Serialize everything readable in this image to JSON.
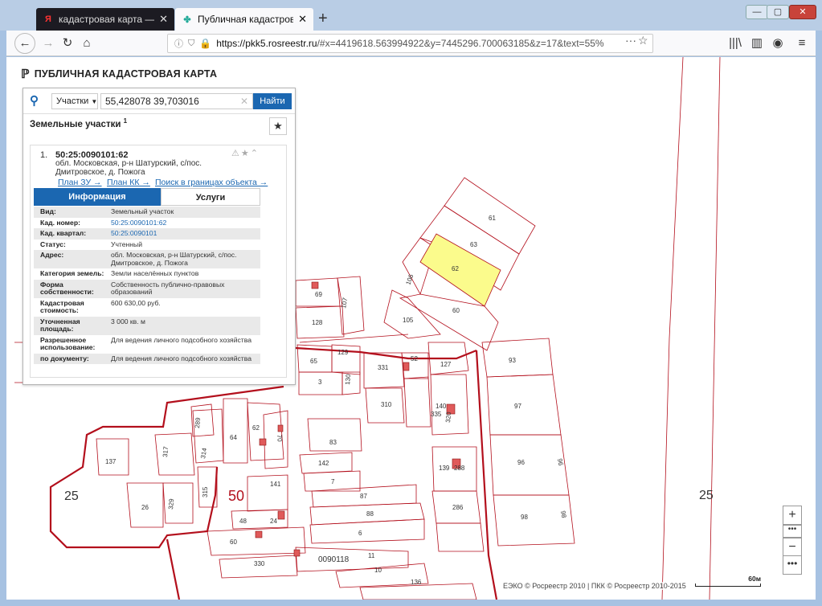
{
  "browser": {
    "tabs": [
      {
        "label": "кадастровая карта — Яндекс",
        "favicon": "Я"
      },
      {
        "label": "Публичная кадастровая карта",
        "favicon": "✤"
      }
    ],
    "new_tab_label": "+",
    "url_host": "https://pkk5.rosreestr.ru",
    "url_rest": "/#x=4419618.563994922&y=7445296.700063185&z=17&text=55%",
    "url_menu_glyph": "···",
    "window_buttons": {
      "min": "—",
      "max": "▢",
      "close": "✕"
    },
    "nav_glyphs": {
      "back": "←",
      "forward": "→",
      "reload": "↻",
      "home": "⌂",
      "bookmark": "☆",
      "library": "|||\\",
      "sidebar": "▥",
      "account": "◉",
      "menu": "≡"
    }
  },
  "header": {
    "title": "ПУБЛИЧНАЯ КАДАСТРОВАЯ КАРТА",
    "logo_glyph": "ℙ"
  },
  "search": {
    "type_label": "Участки",
    "query": "55,428078 39,703016",
    "clear_glyph": "✕",
    "find_label": "Найти",
    "search_glyph": "🔍"
  },
  "results": {
    "section_title": "Земельные участки",
    "count": "1",
    "star_glyph": "★",
    "item": {
      "index": "1.",
      "cad_number": "50:25:0090101:62",
      "address": "обл. Московская, р-н Шатурский, с/пос. Дмитровское, д. Пожога",
      "status_icons": "⚠★⌃",
      "links": [
        "План ЗУ →",
        "План КК →",
        "Поиск в границах объекта →"
      ]
    },
    "tabs": {
      "info": "Информация",
      "services": "Услуги"
    },
    "properties": [
      {
        "key": "Вид:",
        "value": "Земельный участок",
        "link": false
      },
      {
        "key": "Кад. номер:",
        "value": "50:25:0090101:62",
        "link": true
      },
      {
        "key": "Кад. квартал:",
        "value": "50:25:0090101",
        "link": true
      },
      {
        "key": "Статус:",
        "value": "Учтенный",
        "link": false
      },
      {
        "key": "Адрес:",
        "value": "обл. Московская, р-н Шатурский, с/пос. Дмитровское, д. Пожога",
        "link": false
      },
      {
        "key": "Категория земель:",
        "value": "Земли населённых пунктов",
        "link": false
      },
      {
        "key": "Форма собственности:",
        "value": "Собственность публично-правовых образований",
        "link": false
      },
      {
        "key": "Кадастровая стоимость:",
        "value": "600 630,00 руб.",
        "link": false
      },
      {
        "key": "Уточненная площадь:",
        "value": "3 000 кв. м",
        "link": false
      },
      {
        "key": "Разрешенное использование:",
        "value": "Для ведения личного подсобного хозяйства",
        "link": false
      },
      {
        "key": "по документу:",
        "value": "Для ведения личного подсобного хозяйства",
        "link": false
      }
    ]
  },
  "map": {
    "labels": {
      "p61": "61",
      "p63": "63",
      "p62": "62",
      "p106": "106",
      "p60": "60",
      "p105": "105",
      "p69": "69",
      "p107": "107",
      "p128": "128",
      "p65": "65",
      "p129": "129",
      "p52": "52",
      "p127": "127",
      "p93": "93",
      "p3": "3",
      "p130": "130",
      "p331": "331",
      "p310": "310",
      "p140": "140",
      "p335": "335",
      "p320": "320",
      "p97": "97",
      "p289": "289",
      "p62b": "62",
      "p70": "70",
      "p64": "64",
      "p83": "83",
      "p137": "137",
      "p317": "317",
      "p314": "314",
      "p142": "142",
      "p139": "139",
      "p288": "288",
      "p96": "96",
      "p96b": "96",
      "p7": "7",
      "p141": "141",
      "p315": "315",
      "p50": "50",
      "p87": "87",
      "p25a": "25",
      "p25b": "25",
      "p26": "26",
      "p329": "329",
      "p286": "286",
      "p88": "88",
      "p98": "98",
      "p98b": "98",
      "p48": "48",
      "p24": "24",
      "p6": "6",
      "p60b": "60",
      "p330": "330",
      "p11": "11",
      "p10": "10",
      "p136": "136",
      "quarter": "0090118"
    },
    "highlight_color": "#fbfb8c",
    "boundary_color": "#b30f1c"
  },
  "footer": {
    "attribution": "ЕЭКО © Росреестр 2010 | ПКК © Росреестр 2010-2015",
    "scale": "60м"
  },
  "controls": {
    "zoom_in": "+",
    "zoom_dots": "•••",
    "zoom_out": "−",
    "more": "•••"
  }
}
